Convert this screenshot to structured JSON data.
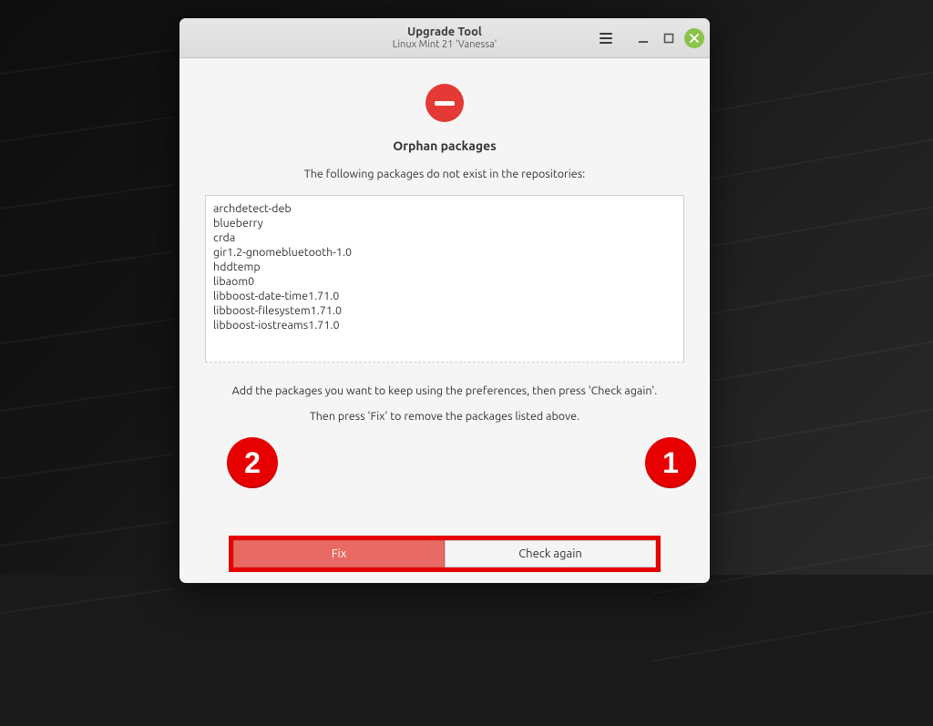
{
  "window": {
    "title": "Upgrade Tool",
    "subtitle": "Linux Mint 21 'Vanessa'"
  },
  "section": {
    "heading": "Orphan packages",
    "description": "The following packages do not exist in the repositories:"
  },
  "packages": [
    "archdetect-deb",
    "blueberry",
    "crda",
    "gir1.2-gnomebluetooth-1.0",
    "hddtemp",
    "libaom0",
    "libboost-date-time1.71.0",
    "libboost-filesystem1.71.0",
    "libboost-iostreams1.71.0"
  ],
  "hints": {
    "line1": "Add the packages you want to keep using the preferences, then press 'Check again'.",
    "line2": "Then press 'Fix' to remove the packages listed above."
  },
  "buttons": {
    "fix": "Fix",
    "check_again": "Check again"
  },
  "callouts": {
    "one": "1",
    "two": "2"
  }
}
